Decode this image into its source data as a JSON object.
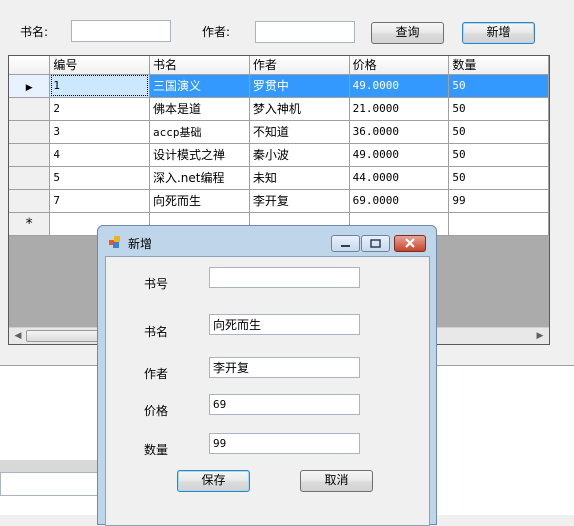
{
  "search": {
    "title_label": "书名:",
    "title_value": "",
    "author_label": "作者:",
    "author_value": "",
    "query_button": "查询",
    "add_button": "新增"
  },
  "grid": {
    "columns": [
      "编号",
      "书名",
      "作者",
      "价格",
      "数量"
    ],
    "rows": [
      {
        "id": "1",
        "title": "三国演义",
        "author": "罗贯中",
        "price": "49.0000",
        "qty": "50"
      },
      {
        "id": "2",
        "title": "佛本是道",
        "author": "梦入神机",
        "price": "21.0000",
        "qty": "50"
      },
      {
        "id": "3",
        "title": "accp基础",
        "author": "不知道",
        "price": "36.0000",
        "qty": "50"
      },
      {
        "id": "4",
        "title": "设计模式之禅",
        "author": "秦小波",
        "price": "49.0000",
        "qty": "50"
      },
      {
        "id": "5",
        "title": "深入.net编程",
        "author": "未知",
        "price": "44.0000",
        "qty": "50"
      },
      {
        "id": "7",
        "title": "向死而生",
        "author": "李开复",
        "price": "69.0000",
        "qty": "99"
      }
    ],
    "selected_marker": "▶",
    "new_row_marker": "*"
  },
  "dialog": {
    "title": "新增",
    "fields": {
      "book_no_label": "书号",
      "book_no_value": "",
      "title_label": "书名",
      "title_value": "向死而生",
      "author_label": "作者",
      "author_value": "李开复",
      "price_label": "价格",
      "price_value": "69",
      "qty_label": "数量",
      "qty_value": "99"
    },
    "save_button": "保存",
    "cancel_button": "取消"
  }
}
